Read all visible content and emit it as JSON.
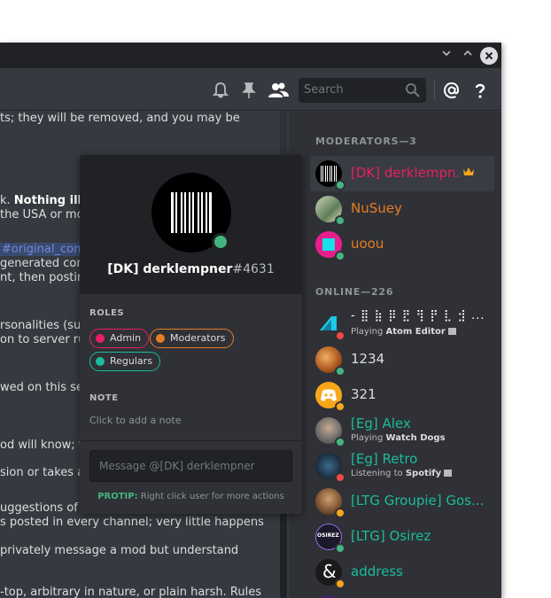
{
  "titlebar": {
    "minimize_icon": "chevron-down-icon",
    "maximize_icon": "chevron-up-icon",
    "close_icon": "close-icon"
  },
  "header": {
    "search_placeholder": "Search",
    "icons": [
      "bell-icon",
      "pin-icon",
      "members-icon",
      "search-icon",
      "mention-icon",
      "help-icon"
    ]
  },
  "chat": {
    "lines": [
      {
        "text": "ts; they will be removed, and you may be"
      },
      {
        "pre": "k. ",
        "bold": "Nothing illeg"
      },
      {
        "text": "the USA or mo"
      },
      {
        "link": "#original_cont"
      },
      {
        "text": "generated cone"
      },
      {
        "text": "nt, then posting"
      },
      {
        "text": "rsonalities (suc"
      },
      {
        "text": "on to server rul"
      },
      {
        "text": "wed on this ser"
      },
      {
        "text": "od will know; t"
      },
      {
        "text": "sion or takes a"
      },
      {
        "text": "uggestions of n"
      },
      {
        "text": "s posted in every channel; very little happens"
      },
      {
        "text": "privately message a mod but understand"
      },
      {
        "text": "-top, arbitrary in nature, or plain harsh. Rules"
      }
    ]
  },
  "members": {
    "moderators_header": "MODERATORS—3",
    "online_header": "ONLINE—226",
    "moderators": [
      {
        "name": "[DK] derklempn...",
        "color": "#e91e63",
        "status": "online",
        "avatar": "barcode",
        "crown": true
      },
      {
        "name": "NuSuey",
        "color": "#e67e22",
        "status": "online",
        "avatar": "photo-green"
      },
      {
        "name": "uoou",
        "color": "#e67e22",
        "status": "online",
        "avatar": "magenta-cyan"
      }
    ],
    "online": [
      {
        "name": "- ⣿ ⣷ ⡿ ⣟ ⢻ ⡟ ⣇ ⣺ ...",
        "color": "#ffffff",
        "status": "dnd",
        "avatar": "cyan-logo",
        "activity_prefix": "Playing",
        "activity": "Atom Editor"
      },
      {
        "name": "1234",
        "color": "#dcddde",
        "status": "online",
        "avatar": "photo-orange"
      },
      {
        "name": "321",
        "color": "#dcddde",
        "status": "idle",
        "avatar": "discord-orange"
      },
      {
        "name": "[Eg] Alex",
        "color": "#1abc9c",
        "status": "online",
        "avatar": "photo-person",
        "activity_prefix": "Playing",
        "activity": "Watch Dogs"
      },
      {
        "name": "[Eg] Retro",
        "color": "#1abc9c",
        "status": "dnd",
        "avatar": "photo-dark",
        "activity_prefix": "Listening to",
        "activity": "Spotify"
      },
      {
        "name": "[LTG Groupie] Gos...",
        "color": "#1abc9c",
        "status": "idle",
        "avatar": "photo-brown"
      },
      {
        "name": "[LTG] Osirez",
        "color": "#1abc9c",
        "status": "online",
        "avatar": "osirez-logo",
        "avatar_text": "OSIREZ"
      },
      {
        "name": "address",
        "color": "#1abc9c",
        "status": "idle",
        "avatar": "ampersand",
        "avatar_text": "&"
      }
    ]
  },
  "popout": {
    "username": "[DK] derklempner",
    "discriminator": "#4631",
    "roles_label": "ROLES",
    "roles": [
      {
        "name": "Admin",
        "color": "#e91e63"
      },
      {
        "name": "Moderators",
        "color": "#e67e22"
      },
      {
        "name": "Regulars",
        "color": "#1abc9c"
      }
    ],
    "note_label": "NOTE",
    "note_placeholder": "Click to add a note",
    "message_placeholder": "Message @[DK] derklempner",
    "protip_label": "PROTIP:",
    "protip_text": "Right click user for more actions"
  },
  "colors": {
    "online": "#43b581",
    "idle": "#faa61a",
    "dnd": "#f04747",
    "background": "#36393f",
    "sidebar": "#2f3136"
  }
}
